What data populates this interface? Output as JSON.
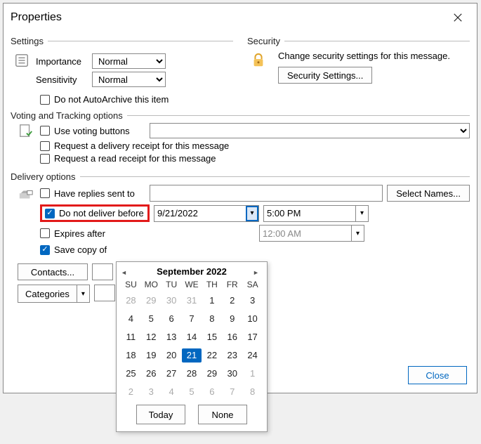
{
  "title": "Properties",
  "settings": {
    "legend": "Settings",
    "importance_label": "Importance",
    "importance_value": "Normal",
    "sensitivity_label": "Sensitivity",
    "sensitivity_value": "Normal",
    "autoarchive_label": "Do not AutoArchive this item",
    "autoarchive_checked": false
  },
  "security": {
    "legend": "Security",
    "message": "Change security settings for this message.",
    "button_label": "Security Settings..."
  },
  "voting": {
    "legend": "Voting and Tracking options",
    "use_voting_label": "Use voting buttons",
    "use_voting_checked": false,
    "delivery_receipt_label": "Request a delivery receipt for this message",
    "delivery_receipt_checked": false,
    "read_receipt_label": "Request a read receipt for this message",
    "read_receipt_checked": false
  },
  "delivery": {
    "legend": "Delivery options",
    "have_replies_label": "Have replies sent to",
    "have_replies_checked": false,
    "have_replies_value": "",
    "select_names_label": "Select Names...",
    "do_not_deliver_label": "Do not deliver before",
    "do_not_deliver_checked": true,
    "do_not_deliver_date": "9/21/2022",
    "do_not_deliver_time": "5:00 PM",
    "expires_label": "Expires after",
    "expires_checked": false,
    "expires_time": "12:00 AM",
    "save_copy_label": "Save copy of",
    "save_copy_checked": true
  },
  "buttons": {
    "contacts_label": "Contacts...",
    "categories_label": "Categories",
    "close_label": "Close"
  },
  "calendar": {
    "title": "September 2022",
    "dow": [
      "SU",
      "MO",
      "TU",
      "WE",
      "TH",
      "FR",
      "SA"
    ],
    "today_label": "Today",
    "none_label": "None",
    "selected_day": 21,
    "weeks": [
      [
        {
          "d": 28,
          "o": true
        },
        {
          "d": 29,
          "o": true
        },
        {
          "d": 30,
          "o": true
        },
        {
          "d": 31,
          "o": true
        },
        {
          "d": 1
        },
        {
          "d": 2
        },
        {
          "d": 3
        }
      ],
      [
        {
          "d": 4
        },
        {
          "d": 5
        },
        {
          "d": 6
        },
        {
          "d": 7
        },
        {
          "d": 8
        },
        {
          "d": 9
        },
        {
          "d": 10
        }
      ],
      [
        {
          "d": 11
        },
        {
          "d": 12
        },
        {
          "d": 13
        },
        {
          "d": 14
        },
        {
          "d": 15
        },
        {
          "d": 16
        },
        {
          "d": 17
        }
      ],
      [
        {
          "d": 18
        },
        {
          "d": 19
        },
        {
          "d": 20
        },
        {
          "d": 21,
          "sel": true
        },
        {
          "d": 22
        },
        {
          "d": 23
        },
        {
          "d": 24
        }
      ],
      [
        {
          "d": 25
        },
        {
          "d": 26
        },
        {
          "d": 27
        },
        {
          "d": 28
        },
        {
          "d": 29
        },
        {
          "d": 30
        },
        {
          "d": 1,
          "o": true
        }
      ],
      [
        {
          "d": 2,
          "o": true
        },
        {
          "d": 3,
          "o": true
        },
        {
          "d": 4,
          "o": true
        },
        {
          "d": 5,
          "o": true
        },
        {
          "d": 6,
          "o": true
        },
        {
          "d": 7,
          "o": true
        },
        {
          "d": 8,
          "o": true
        }
      ]
    ]
  }
}
